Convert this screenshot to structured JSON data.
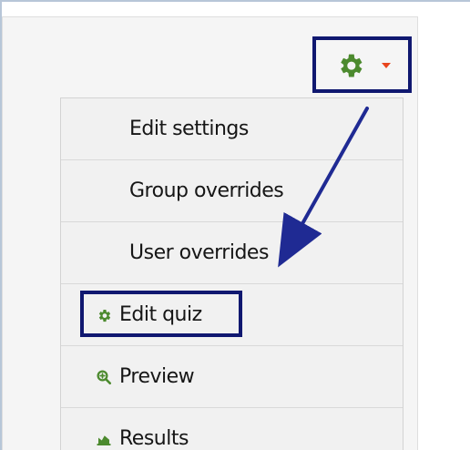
{
  "dropdown_trigger": {
    "icon": "gear-icon",
    "caret_icon": "caret-down-icon",
    "gear_color": "#4c8a2e",
    "caret_color": "#e8451d"
  },
  "menu": {
    "items": [
      {
        "label": "Edit settings",
        "icon": ""
      },
      {
        "label": "Group overrides",
        "icon": ""
      },
      {
        "label": "User overrides",
        "icon": ""
      },
      {
        "label": "Edit quiz",
        "icon": "gear-icon"
      },
      {
        "label": "Preview",
        "icon": "zoom-in-icon"
      },
      {
        "label": "Results",
        "icon": "chart-icon"
      }
    ]
  },
  "annotations": {
    "highlight_color": "#101870",
    "arrow_color": "#1f2a93"
  }
}
